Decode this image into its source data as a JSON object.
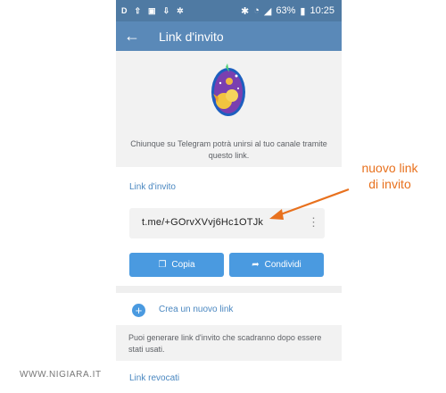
{
  "status_bar": {
    "left_icons": [
      "D",
      "upload-icon",
      "image-icon",
      "download-icon",
      "bug-icon"
    ],
    "battery": "63%",
    "time": "10:25"
  },
  "app_bar": {
    "title": "Link d'invito"
  },
  "hero": {
    "description": "Chiunque su Telegram potrà unirsi al tuo canale tramite questo link."
  },
  "invite_section": {
    "title": "Link d'invito",
    "link": "t.me/+GOrvXVvj6Hc1OTJk",
    "copy_label": "Copia",
    "share_label": "Condividi"
  },
  "create": {
    "label": "Crea un nuovo link",
    "info": "Puoi generare link d'invito che scadranno dopo essere stati usati."
  },
  "revoked": {
    "title": "Link revocati"
  },
  "annotation": {
    "line1": "nuovo link",
    "line2": "di invito",
    "color": "#e8711e"
  },
  "watermark": "WWW.NIGIARA.IT",
  "colors": {
    "status_bar": "#4f7aa3",
    "app_bar": "#5a89b8",
    "accent": "#4a9ae0",
    "section_title": "#4a87c0"
  }
}
